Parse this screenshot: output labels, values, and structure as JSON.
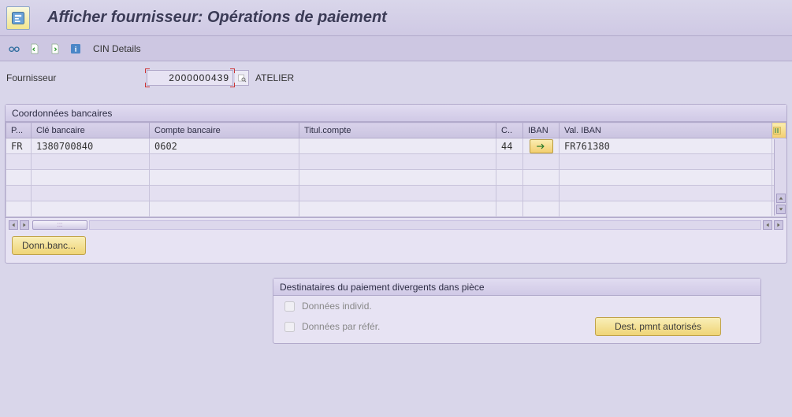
{
  "header": {
    "title": "Afficher fournisseur: Opérations de paiement"
  },
  "toolbar": {
    "cin_details": "CIN Details"
  },
  "vendor": {
    "label": "Fournisseur",
    "code": "2000000439",
    "name": "ATELIER"
  },
  "bank": {
    "group_title": "Coordonnées bancaires",
    "columns": {
      "country": "P...",
      "bank_key": "Clé bancaire",
      "account": "Compte bancaire",
      "holder": "Titul.compte",
      "ctrl": "C..",
      "iban_btn": "IBAN",
      "iban_val": "Val. IBAN"
    },
    "rows": [
      {
        "country": "FR",
        "bank_key": "1380700840",
        "account": "0602",
        "holder": "",
        "ctrl": "44",
        "iban_val": "FR761380"
      }
    ],
    "button": "Donn.banc..."
  },
  "divergent": {
    "group_title": "Destinataires du paiement divergents dans pièce",
    "individual": "Données individ.",
    "by_ref": "Données par référ.",
    "auth_button": "Dest. pmnt autorisés"
  }
}
